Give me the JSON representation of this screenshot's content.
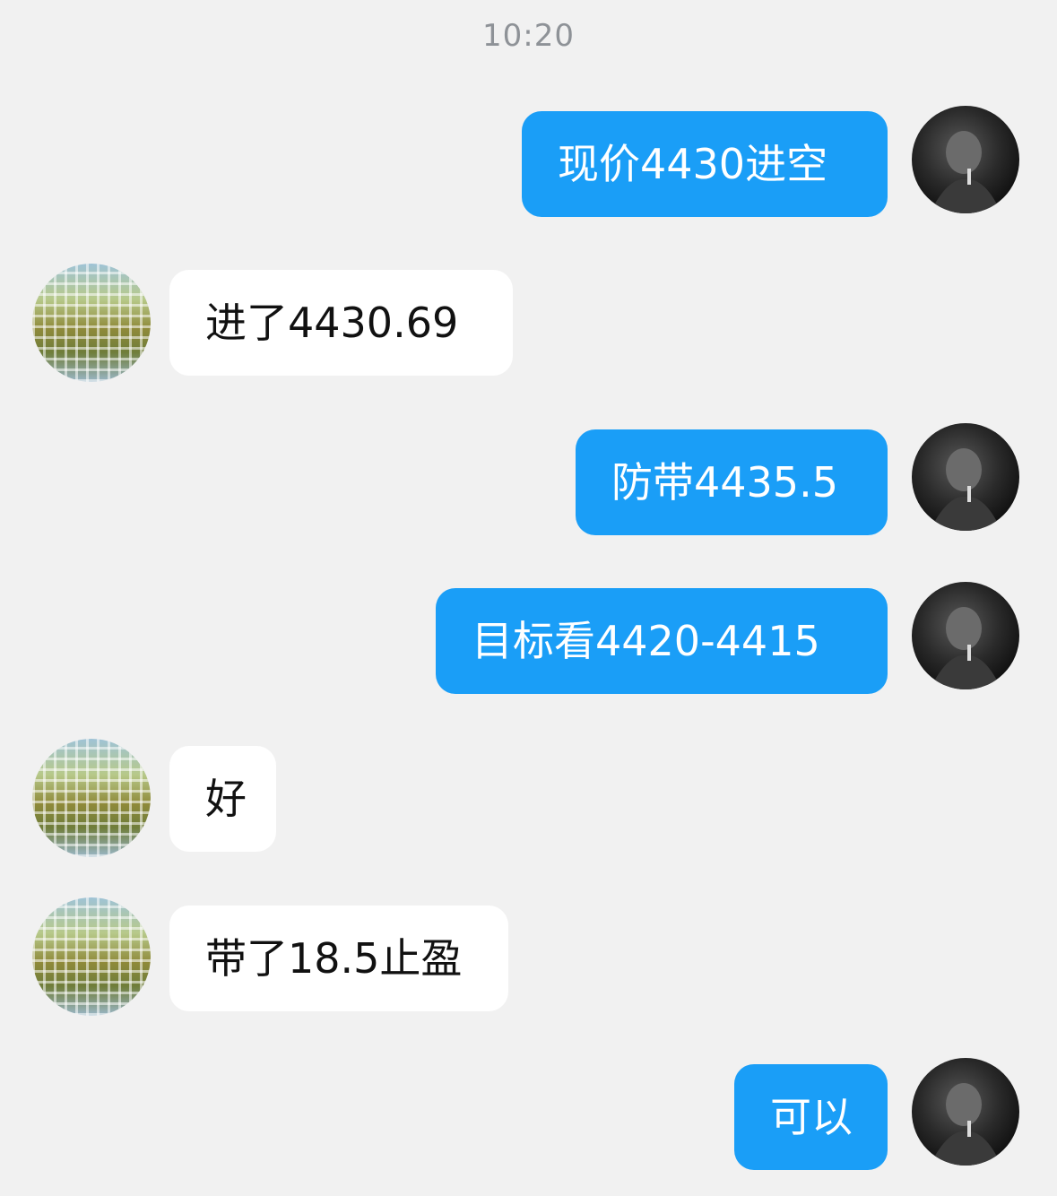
{
  "timestamp": "10:20",
  "messages": [
    {
      "side": "out",
      "text": "现价4430进空"
    },
    {
      "side": "in",
      "text": "进了4430.69"
    },
    {
      "side": "out",
      "text": "防带4435.5"
    },
    {
      "side": "out",
      "text": "目标看4420-4415"
    },
    {
      "side": "in",
      "text": "好"
    },
    {
      "side": "in",
      "text": "带了18.5止盈"
    },
    {
      "side": "out",
      "text": "可以"
    }
  ],
  "colors": {
    "background": "#f1f1f1",
    "outgoing_bubble": "#1a9ef7",
    "incoming_bubble": "#ffffff"
  }
}
